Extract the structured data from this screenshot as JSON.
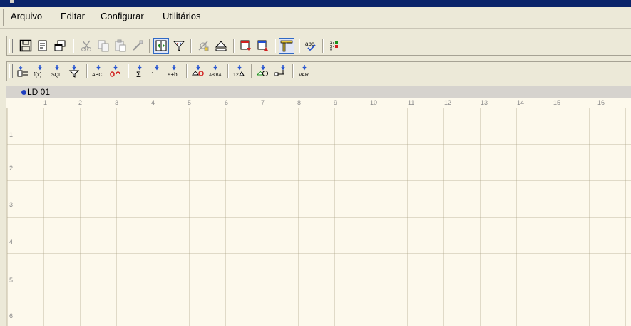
{
  "menu": {
    "items": [
      {
        "label": "Arquivo"
      },
      {
        "label": "Editar"
      },
      {
        "label": "Configurar"
      },
      {
        "label": "Utilitários"
      }
    ]
  },
  "toolbar1": {
    "buttons": [
      {
        "icon": "floppy-save-icon"
      },
      {
        "icon": "print-preview-icon"
      },
      {
        "icon": "windows-icon"
      },
      {
        "icon": "scissors-icon"
      },
      {
        "icon": "copy-icon"
      },
      {
        "icon": "paste-icon"
      },
      {
        "icon": "format-painter-icon"
      },
      {
        "icon": "split-view-icon",
        "active": true
      },
      {
        "icon": "funnel-icon"
      },
      {
        "icon": "satellite-icon"
      },
      {
        "icon": "eject-icon"
      },
      {
        "icon": "report-export-icon"
      },
      {
        "icon": "report-import-icon"
      },
      {
        "icon": "ruler-icon",
        "active": true
      },
      {
        "icon": "spell-check-icon",
        "text": "abc"
      },
      {
        "icon": "tree-icon"
      }
    ]
  },
  "toolbar2": {
    "buttons": [
      {
        "icon": "insert-group-icon"
      },
      {
        "icon": "insert-formula-icon",
        "text": "f(x)"
      },
      {
        "icon": "insert-sql-icon",
        "text": "SQL"
      },
      {
        "icon": "insert-filter-icon"
      },
      {
        "icon": "insert-text-icon",
        "text": "ABC"
      },
      {
        "icon": "insert-link-icon"
      },
      {
        "icon": "insert-sum-icon",
        "text": "Σ"
      },
      {
        "icon": "insert-sequence-icon",
        "text": "1...."
      },
      {
        "icon": "insert-expression-icon",
        "text": "a+b"
      },
      {
        "icon": "insert-db-field-icon"
      },
      {
        "icon": "insert-abba-icon",
        "text": "AB:BA"
      },
      {
        "icon": "insert-numeric-icon",
        "text": "12"
      },
      {
        "icon": "insert-shape-icon"
      },
      {
        "icon": "insert-connector-icon"
      },
      {
        "icon": "insert-var-icon",
        "text": "VAR"
      }
    ]
  },
  "document": {
    "tab_label": "LD 01"
  },
  "ruler": {
    "columns": [
      "1",
      "2",
      "3",
      "4",
      "5",
      "6",
      "7",
      "8",
      "9",
      "10",
      "11",
      "12",
      "13",
      "14",
      "15",
      "16"
    ]
  },
  "rows": [
    "1",
    "2",
    "3",
    "4",
    "5",
    "6"
  ],
  "colors": {
    "canvas_bg": "#fdf9ec",
    "chrome": "#ece9d8",
    "active_border": "#316ac5",
    "title_blue": "#0a246a",
    "icon_blue": "#1f4fd0",
    "icon_red": "#d02020"
  }
}
